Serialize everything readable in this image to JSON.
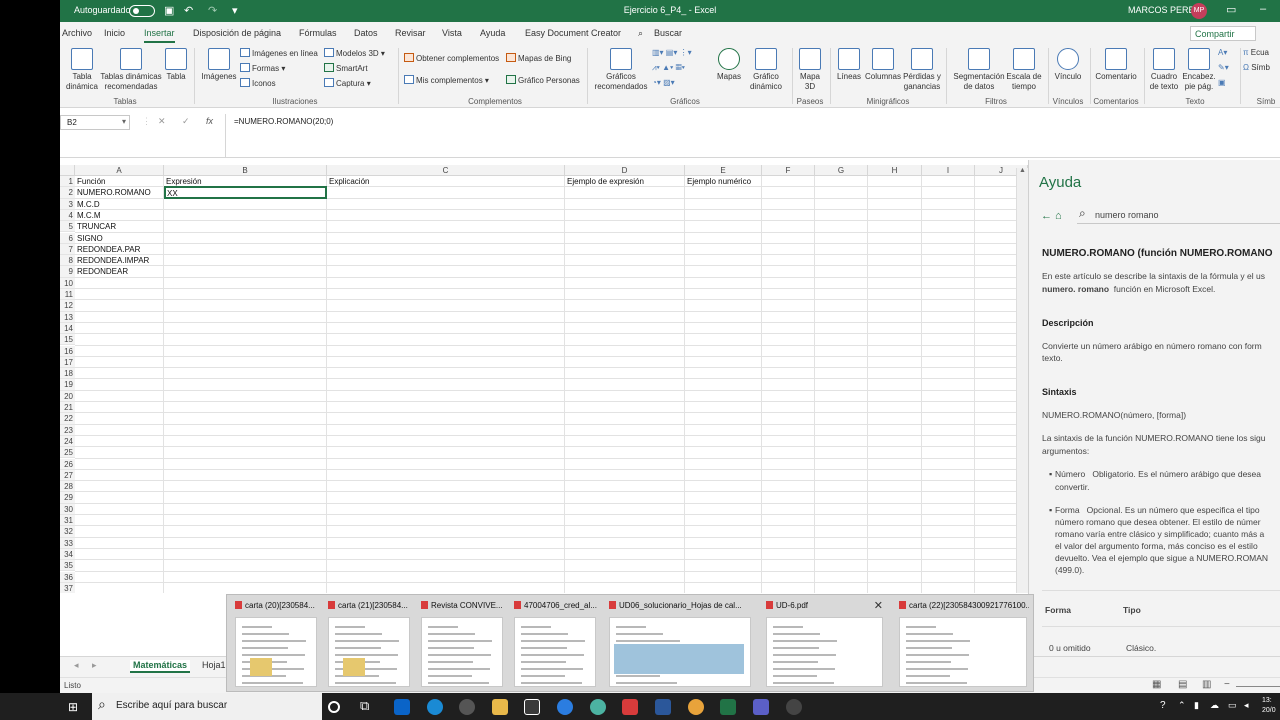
{
  "titlebar": {
    "autosave_label": "Autoguardado",
    "document_title": "Ejercicio 6_P4_  -  Excel",
    "user_name": "MARCOS PEREZ",
    "user_initials": "MP"
  },
  "ribbon_tabs": [
    "Archivo",
    "Inicio",
    "Insertar",
    "Disposición de página",
    "Fórmulas",
    "Datos",
    "Revisar",
    "Vista",
    "Ayuda",
    "Easy Document Creator",
    "Buscar"
  ],
  "active_tab": "Insertar",
  "share_label": "Compartir",
  "ribbon": {
    "tablas": {
      "label": "Tablas",
      "tabla_dinamica": "Tabla dinámica",
      "tablas_recomendadas": "Tablas dinámicas recomendadas",
      "tabla": "Tabla"
    },
    "ilustraciones": {
      "label": "Ilustraciones",
      "imagenes": "Imágenes",
      "imagenes_en_linea": "Imágenes en línea",
      "formas": "Formas",
      "iconos": "Iconos",
      "modelos_3d": "Modelos 3D",
      "smartart": "SmartArt",
      "captura": "Captura"
    },
    "complementos": {
      "label": "Complementos",
      "obtener": "Obtener complementos",
      "mis": "Mis complementos",
      "mapas_bing": "Mapas de Bing",
      "grafico_personas": "Gráfico Personas"
    },
    "graficos": {
      "label": "Gráficos",
      "recomendados": "Gráficos recomendados",
      "mapas": "Mapas",
      "grafico_dinamico": "Gráfico dinámico"
    },
    "paseos": {
      "label": "Paseos",
      "mapa_3d": "Mapa 3D"
    },
    "minigraficos": {
      "label": "Minigráficos",
      "lineas": "Líneas",
      "columnas": "Columnas",
      "perdidas": "Pérdidas y ganancias"
    },
    "filtros": {
      "label": "Filtros",
      "segmentacion": "Segmentación de datos",
      "escala": "Escala de tiempo"
    },
    "vinculos": {
      "label": "Vínculos",
      "vinculo": "Vínculo"
    },
    "comentarios": {
      "label": "Comentarios",
      "comentario": "Comentario"
    },
    "texto": {
      "label": "Texto",
      "cuadro": "Cuadro de texto",
      "encabez": "Encabez. pie pág."
    },
    "simbolos": {
      "label": "Símb",
      "ecuacion": "Ecua",
      "simbolo": "Símb"
    }
  },
  "formula_bar": {
    "name_box": "B2",
    "formula": "=NUMERO.ROMANO(20;0)"
  },
  "grid": {
    "columns": [
      "A",
      "B",
      "C",
      "D",
      "E",
      "F",
      "G",
      "H",
      "I",
      "J"
    ],
    "row_count": 43,
    "headers": {
      "A": "Función",
      "B": "Expresión",
      "C": "Explicación",
      "D": "Ejemplo de expresión",
      "E": "Ejemplo numérico"
    },
    "functions": [
      "NUMERO.ROMANO",
      "M.C.D",
      "M.C.M",
      "TRUNCAR",
      "SIGNO",
      "REDONDEA.PAR",
      "REDONDEA.IMPAR",
      "REDONDEAR"
    ],
    "b2_value": "XX"
  },
  "help": {
    "title": "Ayuda",
    "search_value": "numero romano",
    "article_title": "NUMERO.ROMANO (función NUMERO.ROMANO",
    "intro_1": "En este artículo se describe la sintaxis de la fórmula y el us",
    "intro_bold": "numero. romano",
    "intro_2": "función en Microsoft Excel.",
    "descripcion_h": "Descripción",
    "descripcion_1": "Convierte un número arábigo en número romano con form",
    "descripcion_2": "texto.",
    "sintaxis_h": "Sintaxis",
    "sintaxis": "NUMERO.ROMANO(número, [forma])",
    "sintaxis_desc_1": "La sintaxis de la función NUMERO.ROMANO tiene los sigu",
    "sintaxis_desc_2": "argumentos:",
    "arg1_name": "Número",
    "arg1_desc_1": "Obligatorio. Es el número arábigo que desea",
    "arg1_desc_2": "convertir.",
    "arg2_name": "Forma",
    "arg2_desc_1": "Opcional. Es un número que especifica el tipo",
    "arg2_desc_2": "número romano que desea obtener. El estilo de númer",
    "arg2_desc_3": "romano varía entre clásico y simplificado; cuanto más a",
    "arg2_desc_4": "el valor del argumento forma, más conciso es el estilo",
    "arg2_desc_5": "devuelto. Vea el ejemplo que sigue a NUMERO.ROMAN",
    "arg2_desc_6": "(499.0).",
    "table_col1": "Forma",
    "table_col2": "Tipo",
    "table_row1_c1": "0 u omitido",
    "table_row1_c2": "Clásico."
  },
  "sheet_tabs": [
    "Matemáticas",
    "Hoja1"
  ],
  "status": "Listo",
  "thumbnails": [
    "carta (20)[230584...",
    "carta (21)[230584...",
    "Revista CONVIVE...",
    "47004706_cred_al...",
    "UD06_solucionario_Hojas de cal...",
    "UD-6.pdf",
    "carta (22)[230584300921776100..."
  ],
  "taskbar": {
    "search_placeholder": "Escribe aquí para buscar",
    "time": "13:",
    "date": "20/0"
  },
  "colors": {
    "excel_green": "#217346",
    "avatar": "#c43e5b"
  }
}
